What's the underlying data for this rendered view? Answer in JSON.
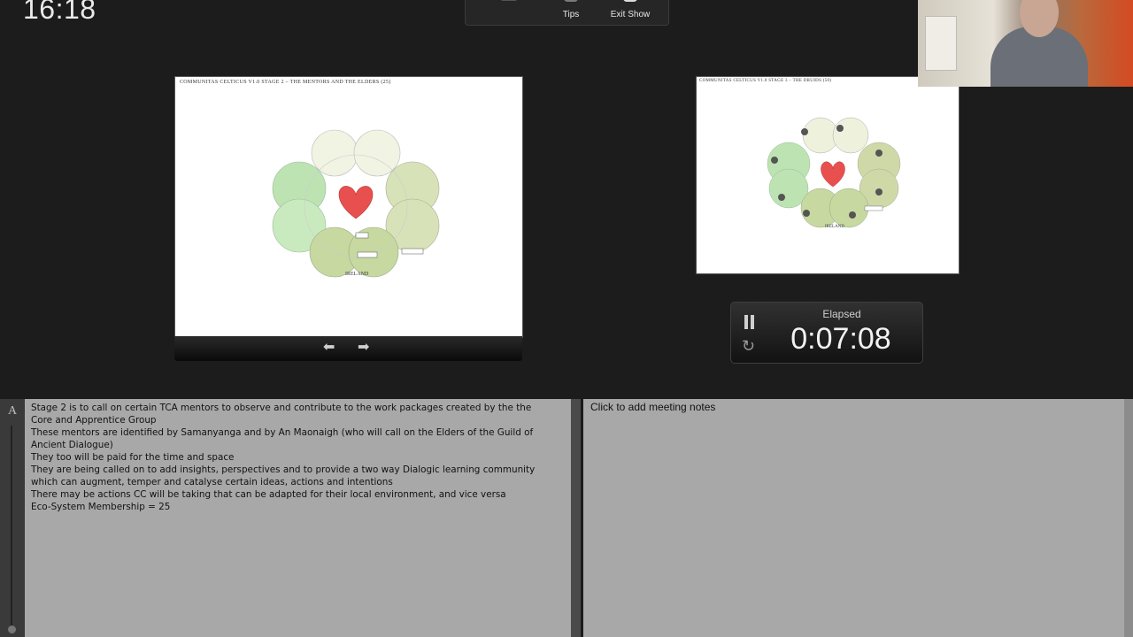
{
  "clock": "16:18",
  "toolbar": {
    "tips_label": "Tips",
    "exit_label": "Exit Show"
  },
  "current_slide": {
    "title": "COMMUNITAS CELTICUS V1.0 STAGE 2 – THE MENTORS AND THE ELDERS (25)",
    "map_label": "IRELAND"
  },
  "next_slide": {
    "title": "COMMUNITAS CELTICUS V1.0 STAGE 3 – THE DRUIDS (50)",
    "map_label": "IRELAND"
  },
  "timer": {
    "label": "Elapsed",
    "value": "0:07:08"
  },
  "presenter_notes": {
    "font_button": "A",
    "lines": [
      "Stage 2 is to call on certain TCA mentors to observe and contribute to the work packages created by the the Core and Apprentice Group",
      "These mentors are identified by Samanyanga and by An Maonaigh (who will call on the Elders of the Guild of Ancient Dialogue)",
      "They too will be paid for the time and space",
      "They are being called on to add insights, perspectives and to provide a two way Dialogic learning community which can augment, temper and catalyse certain ideas, actions and intentions",
      "There may be actions CC will be taking that can be adapted for their local environment, and vice versa",
      "Eco-System Membership = 25"
    ]
  },
  "meeting_notes": {
    "placeholder": "Click to add meeting notes"
  },
  "colors": {
    "background": "#1c1c1c",
    "notes_bg": "#a8a8a8",
    "heart": "#e8504f",
    "petal_green": "#bde3b3",
    "petal_olive": "#cfd9a8"
  }
}
